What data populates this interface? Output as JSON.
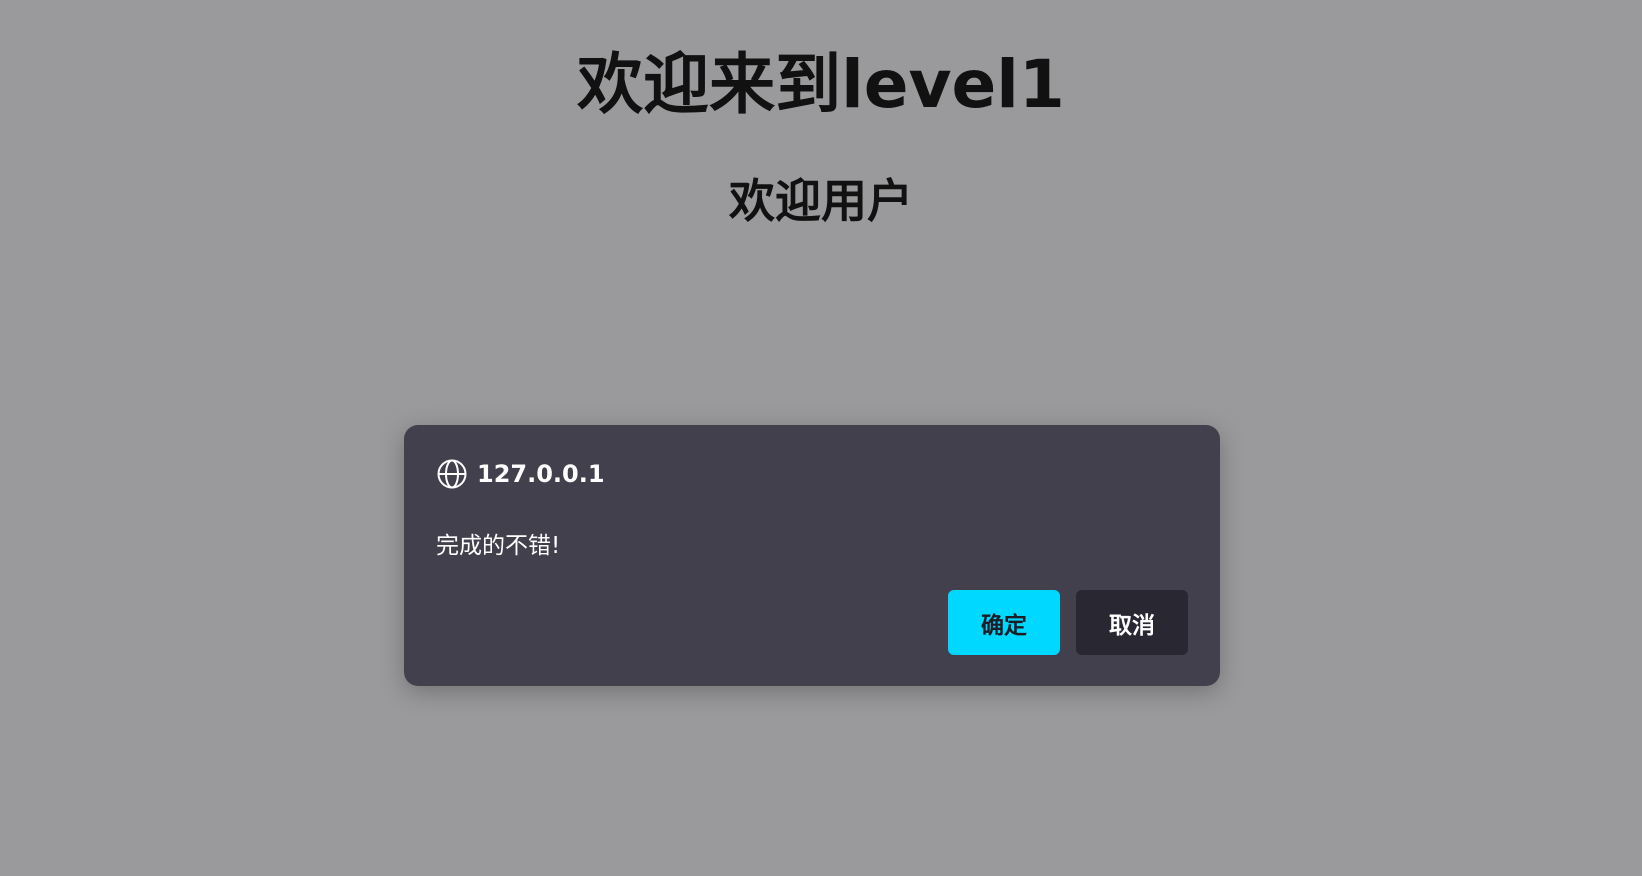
{
  "page": {
    "title": "欢迎来到level1",
    "subtitle": "欢迎用户"
  },
  "dialog": {
    "origin": "127.0.0.1",
    "origin_icon": "globe-icon",
    "message": "完成的不错!",
    "ok_label": "确定",
    "cancel_label": "取消"
  },
  "colors": {
    "page_background": "#9a9a9c",
    "dialog_background": "#42404d",
    "ok_button": "#00d8ff",
    "cancel_button": "#292732"
  }
}
